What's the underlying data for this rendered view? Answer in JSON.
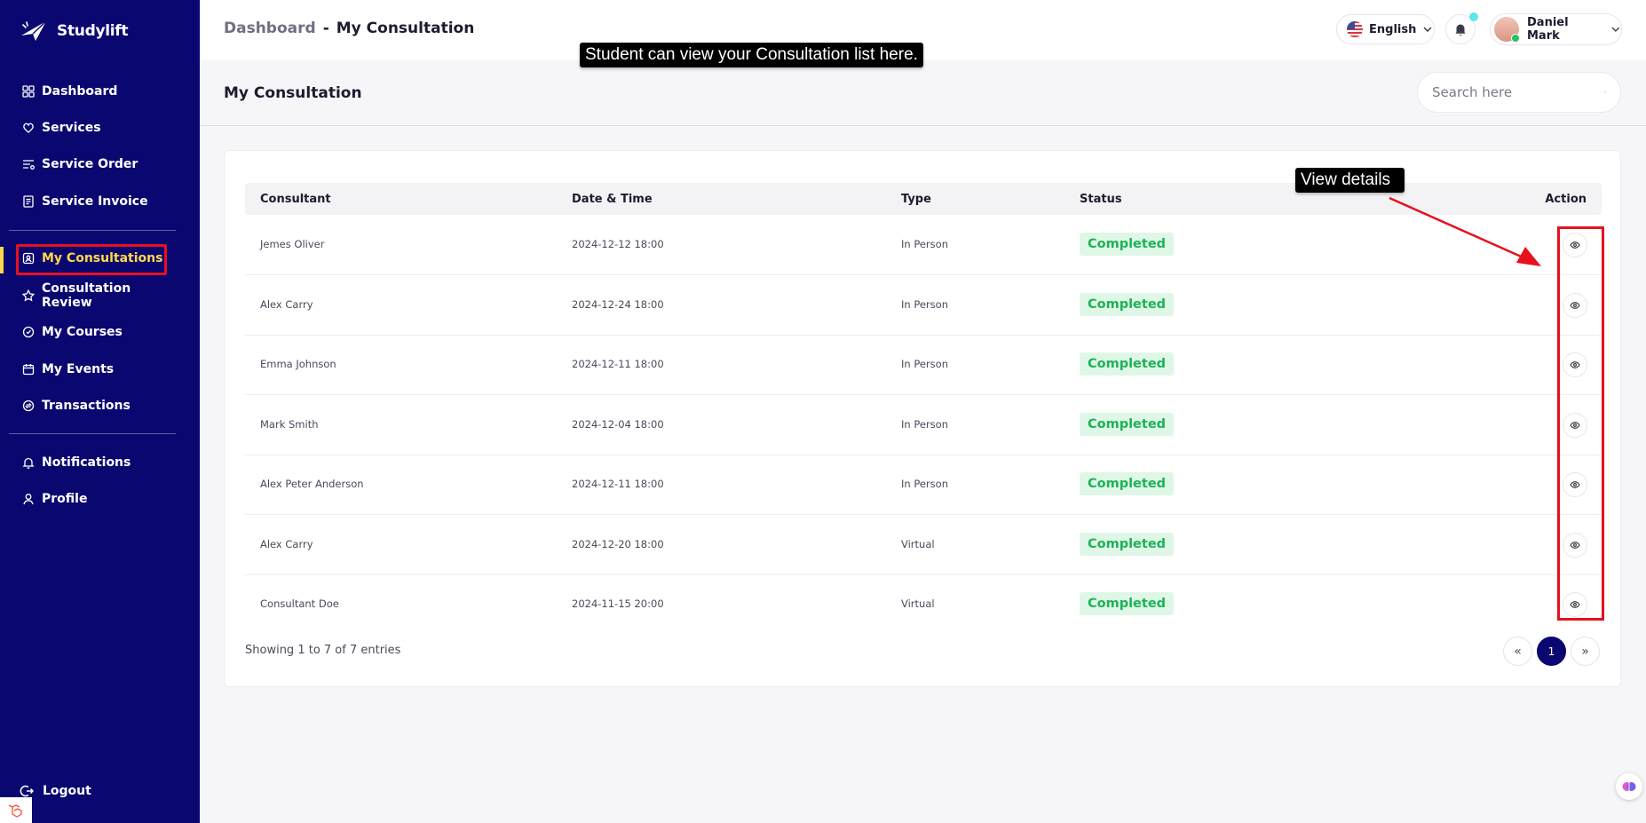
{
  "app": {
    "name": "Studylift"
  },
  "sidebar": {
    "items": [
      {
        "label": "Dashboard",
        "icon": "grid-icon"
      },
      {
        "label": "Services",
        "icon": "services-icon"
      },
      {
        "label": "Service Order",
        "icon": "list-icon"
      },
      {
        "label": "Service Invoice",
        "icon": "invoice-icon"
      },
      {
        "label": "My Consultations",
        "icon": "consultation-icon",
        "active": true
      },
      {
        "label": "Consultation Review",
        "icon": "star-icon"
      },
      {
        "label": "My Courses",
        "icon": "courses-icon"
      },
      {
        "label": "My Events",
        "icon": "calendar-icon"
      },
      {
        "label": "Transactions",
        "icon": "transactions-icon"
      },
      {
        "label": "Notifications",
        "icon": "bell-icon"
      },
      {
        "label": "Profile",
        "icon": "user-icon"
      }
    ],
    "logout_label": "Logout"
  },
  "header": {
    "breadcrumb_root": "Dashboard",
    "breadcrumb_sep": "-",
    "breadcrumb_current": "My Consultation",
    "language": "English",
    "user_name": "Daniel Mark"
  },
  "tooltips": {
    "main": "Student can view your Consultation list here.",
    "view": "View details"
  },
  "page": {
    "title": "My Consultation",
    "search_placeholder": "Search here"
  },
  "table": {
    "columns": [
      "Consultant",
      "Date & Time",
      "Type",
      "Status",
      "Action"
    ],
    "rows": [
      {
        "consultant": "Jemes Oliver",
        "datetime": "2024-12-12 18:00",
        "type": "In Person",
        "status": "Completed"
      },
      {
        "consultant": "Alex Carry",
        "datetime": "2024-12-24 18:00",
        "type": "In Person",
        "status": "Completed"
      },
      {
        "consultant": "Emma Johnson",
        "datetime": "2024-12-11 18:00",
        "type": "In Person",
        "status": "Completed"
      },
      {
        "consultant": "Mark Smith",
        "datetime": "2024-12-04 18:00",
        "type": "In Person",
        "status": "Completed"
      },
      {
        "consultant": "Alex Peter Anderson",
        "datetime": "2024-12-11 18:00",
        "type": "In Person",
        "status": "Completed"
      },
      {
        "consultant": "Alex Carry",
        "datetime": "2024-12-20 18:00",
        "type": "Virtual",
        "status": "Completed"
      },
      {
        "consultant": "Consultant Doe",
        "datetime": "2024-11-15 20:00",
        "type": "Virtual",
        "status": "Completed"
      }
    ],
    "entries_text": "Showing 1 to 7 of 7 entries"
  },
  "pagination": {
    "prev": "«",
    "current": "1",
    "next": "»"
  },
  "colors": {
    "sidebar_bg": "#0a0870",
    "active_text": "#ffd84a",
    "highlight_box": "#e8101e",
    "status_green": "#1eb257",
    "status_bg": "#dff7e7"
  }
}
